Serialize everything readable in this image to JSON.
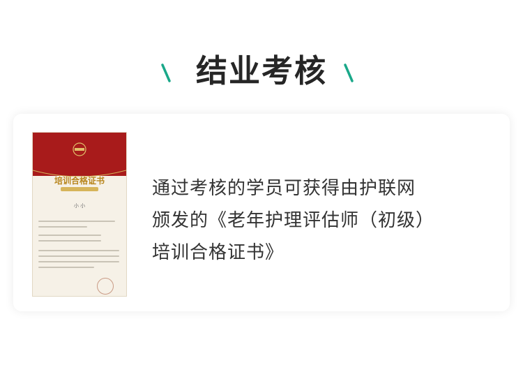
{
  "section": {
    "title": "结业考核"
  },
  "card": {
    "certificate": {
      "title": "培训合格证书",
      "name": "小 小"
    },
    "description_lines": [
      "通过考核的学员可获得由护联网",
      "颁发的《老年护理评估师（初级）",
      "培训合格证书》"
    ]
  },
  "colors": {
    "accent": "#1aa889",
    "title": "#262626",
    "body_text": "#333333",
    "certificate_red": "#a81b1b",
    "certificate_gold": "#b8861e"
  }
}
